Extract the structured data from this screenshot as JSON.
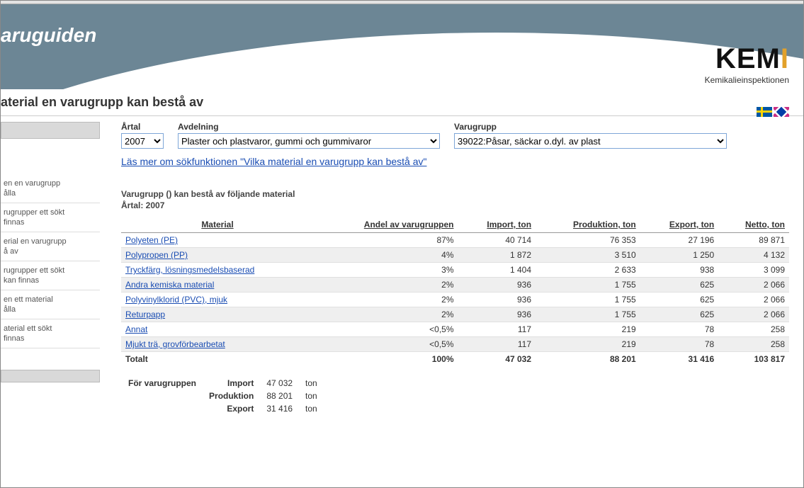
{
  "header": {
    "app_title": "aruguiden"
  },
  "logo": {
    "text_main": "KEM",
    "text_bar": "I",
    "subtitle": "Kemikalieinspektionen"
  },
  "page_title": "aterial en varugrupp kan bestå av",
  "filters": {
    "year_label": "Årtal",
    "year_value": "2007",
    "dept_label": "Avdelning",
    "dept_value": "Plaster och plastvaror, gummi och gummivaror",
    "group_label": "Varugrupp",
    "group_value": "39022:Påsar, säckar o.dyl. av plast"
  },
  "help_link": "Läs mer om sökfunktionen \"Vilka material en varugrupp kan bestå av\"",
  "section": {
    "line1": "Varugrupp () kan bestå av följande material",
    "line2": "Årtal: 2007"
  },
  "columns": {
    "material": "Material",
    "share": "Andel av varugruppen",
    "import": "Import, ton",
    "prod": "Produktion, ton",
    "export": "Export, ton",
    "netto": "Netto, ton"
  },
  "rows": [
    {
      "material": "Polyeten (PE)",
      "share": "87%",
      "import": "40 714",
      "prod": "76 353",
      "export": "27 196",
      "netto": "89 871"
    },
    {
      "material": "Polypropen (PP)",
      "share": "4%",
      "import": "1 872",
      "prod": "3 510",
      "export": "1 250",
      "netto": "4 132"
    },
    {
      "material": "Tryckfärg, lösningsmedelsbaserad",
      "share": "3%",
      "import": "1 404",
      "prod": "2 633",
      "export": "938",
      "netto": "3 099"
    },
    {
      "material": "Andra kemiska material",
      "share": "2%",
      "import": "936",
      "prod": "1 755",
      "export": "625",
      "netto": "2 066"
    },
    {
      "material": "Polyvinylklorid (PVC), mjuk",
      "share": "2%",
      "import": "936",
      "prod": "1 755",
      "export": "625",
      "netto": "2 066"
    },
    {
      "material": "Returpapp",
      "share": "2%",
      "import": "936",
      "prod": "1 755",
      "export": "625",
      "netto": "2 066"
    },
    {
      "material": "Annat",
      "share": "<0,5%",
      "import": "117",
      "prod": "219",
      "export": "78",
      "netto": "258"
    },
    {
      "material": "Mjukt trä, grovförbearbetat",
      "share": "<0,5%",
      "import": "117",
      "prod": "219",
      "export": "78",
      "netto": "258"
    }
  ],
  "total": {
    "label": "Totalt",
    "share": "100%",
    "import": "47 032",
    "prod": "88 201",
    "export": "31 416",
    "netto": "103 817"
  },
  "summary": {
    "heading": "För varugruppen",
    "rows": [
      {
        "label": "Import",
        "value": "47 032",
        "unit": "ton"
      },
      {
        "label": "Produktion",
        "value": "88 201",
        "unit": "ton"
      },
      {
        "label": "Export",
        "value": "31 416",
        "unit": "ton"
      }
    ]
  },
  "sidebar": {
    "items": [
      "en en varugrupp\nålla",
      "rugrupper ett sökt\nfinnas",
      "erial en varugrupp\nå av",
      "rugrupper ett sökt\nkan finnas",
      "en ett material\nålla",
      "aterial ett sökt\nfinnas"
    ]
  }
}
